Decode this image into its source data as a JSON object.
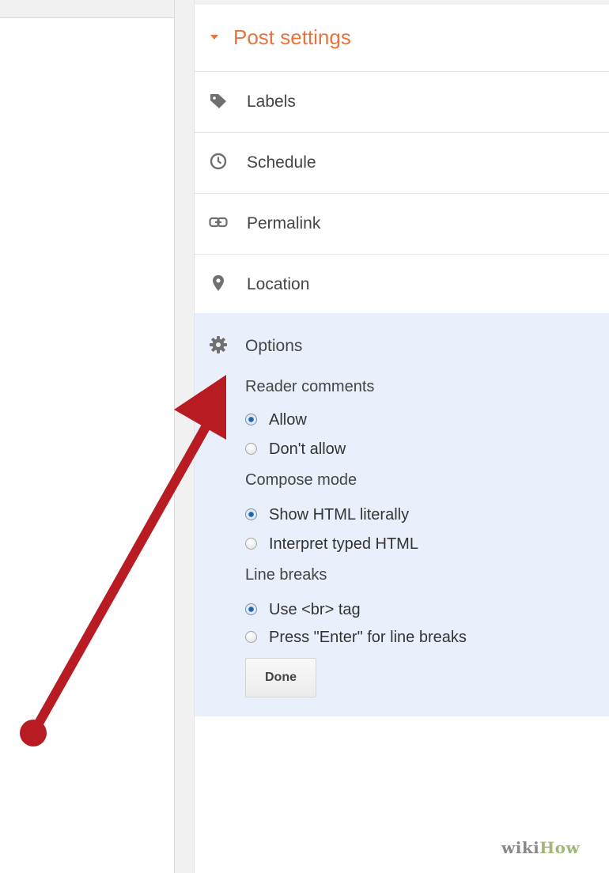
{
  "header": {
    "title": "Post settings"
  },
  "sections": [
    {
      "label": "Labels",
      "icon": "tag-icon"
    },
    {
      "label": "Schedule",
      "icon": "clock-icon"
    },
    {
      "label": "Permalink",
      "icon": "link-icon"
    },
    {
      "label": "Location",
      "icon": "map-pin-icon"
    }
  ],
  "options": {
    "label": "Options",
    "icon": "gear-icon",
    "reader_comments": {
      "title": "Reader comments",
      "choices": [
        "Allow",
        "Don't allow"
      ],
      "selected": "Allow"
    },
    "compose_mode": {
      "title": "Compose mode",
      "choices": [
        "Show HTML literally",
        "Interpret typed HTML"
      ],
      "selected": "Show HTML literally"
    },
    "line_breaks": {
      "title": "Line breaks",
      "choices": [
        "Use <br> tag",
        "Press \"Enter\" for line breaks"
      ],
      "selected": "Use <br> tag"
    },
    "done_label": "Done"
  },
  "watermark": {
    "part1": "wiki",
    "part2": "How"
  },
  "colors": {
    "accent": "#e8743b",
    "options_bg": "#e9f0fb",
    "arrow": "#b81c22"
  }
}
